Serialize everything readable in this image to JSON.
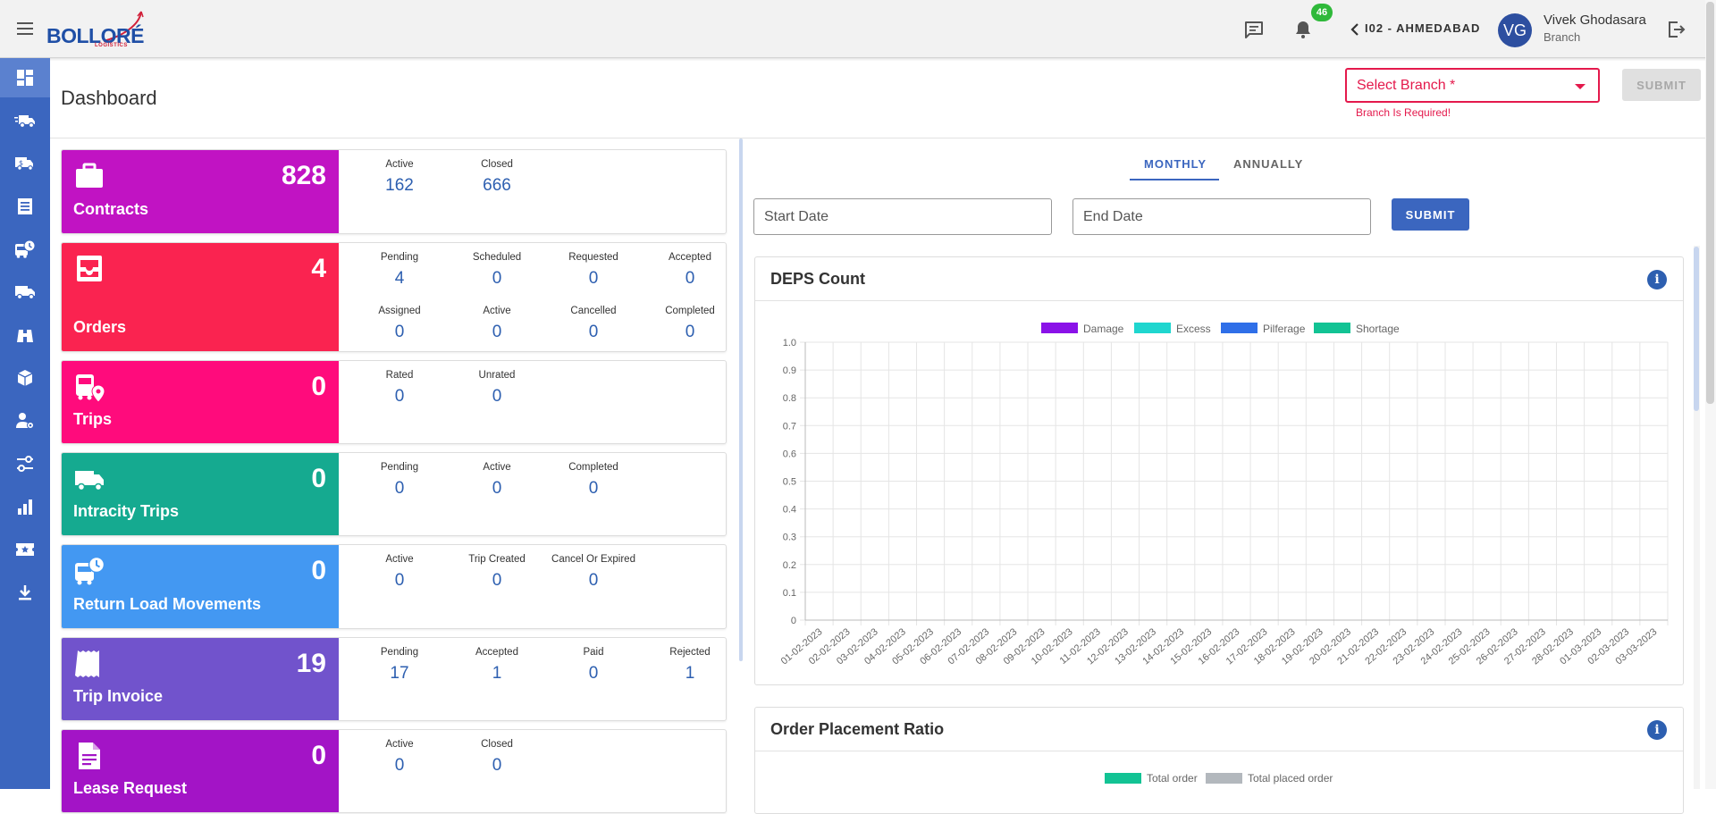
{
  "header": {
    "logo_text": "BOLLORÉ",
    "logo_sub": "LOGISTICS",
    "notification_count": "46",
    "branch_code": "I02 - AHMEDABAD",
    "avatar_initials": "VG",
    "user_name": "Vivek Ghodasara",
    "user_role": "Branch"
  },
  "page": {
    "title": "Dashboard",
    "branch_select_placeholder": "Select Branch *",
    "branch_error": "Branch Is Required!",
    "submit_label": "SUBMIT"
  },
  "sidebar": {
    "items": [
      {
        "icon": "dashboard-icon"
      },
      {
        "icon": "truck-fast-icon"
      },
      {
        "icon": "truck-money-icon"
      },
      {
        "icon": "list-document-icon"
      },
      {
        "icon": "bus-clock-icon"
      },
      {
        "icon": "delivery-truck-icon"
      },
      {
        "icon": "binoculars-icon"
      },
      {
        "icon": "package-icon"
      },
      {
        "icon": "user-settings-icon"
      },
      {
        "icon": "sliders-icon"
      },
      {
        "icon": "bar-chart-icon"
      },
      {
        "icon": "ticket-icon"
      },
      {
        "icon": "download-icon"
      }
    ]
  },
  "cards": [
    {
      "title": "Contracts",
      "count": "828",
      "color": "#c113c3",
      "icon": "briefcase-icon",
      "stats": [
        {
          "label": "Active",
          "value": "162"
        },
        {
          "label": "Closed",
          "value": "666"
        }
      ]
    },
    {
      "title": "Orders",
      "count": "4",
      "color": "#fa2350",
      "icon": "inbox-icon",
      "stats": [
        {
          "label": "Pending",
          "value": "4"
        },
        {
          "label": "Scheduled",
          "value": "0"
        },
        {
          "label": "Requested",
          "value": "0"
        },
        {
          "label": "Accepted",
          "value": "0"
        },
        {
          "label": "Assigned",
          "value": "0"
        },
        {
          "label": "Active",
          "value": "0"
        },
        {
          "label": "Cancelled",
          "value": "0"
        },
        {
          "label": "Completed",
          "value": "0"
        }
      ]
    },
    {
      "title": "Trips",
      "count": "0",
      "color": "#ff0b7c",
      "icon": "bus-pin-icon",
      "stats": [
        {
          "label": "Rated",
          "value": "0"
        },
        {
          "label": "Unrated",
          "value": "0"
        }
      ]
    },
    {
      "title": "Intracity Trips",
      "count": "0",
      "color": "#15aa90",
      "icon": "truck-icon",
      "stats": [
        {
          "label": "Pending",
          "value": "0"
        },
        {
          "label": "Active",
          "value": "0"
        },
        {
          "label": "Completed",
          "value": "0"
        }
      ]
    },
    {
      "title": "Return Load Movements",
      "count": "0",
      "color": "#4398f2",
      "icon": "bus-clock-icon",
      "stats": [
        {
          "label": "Active",
          "value": "0"
        },
        {
          "label": "Trip Created",
          "value": "0"
        },
        {
          "label": "Cancel Or Expired",
          "value": "0"
        }
      ]
    },
    {
      "title": "Trip Invoice",
      "count": "19",
      "color": "#7153cc",
      "icon": "receipt-icon",
      "stats": [
        {
          "label": "Pending",
          "value": "17"
        },
        {
          "label": "Accepted",
          "value": "1"
        },
        {
          "label": "Paid",
          "value": "0"
        },
        {
          "label": "Rejected",
          "value": "1"
        }
      ]
    },
    {
      "title": "Lease Request",
      "count": "0",
      "color": "#a314c6",
      "icon": "document-icon",
      "stats": [
        {
          "label": "Active",
          "value": "0"
        },
        {
          "label": "Closed",
          "value": "0"
        }
      ]
    }
  ],
  "tabs": [
    {
      "label": "MONTHLY"
    },
    {
      "label": "ANNUALLY"
    }
  ],
  "filters": {
    "start_placeholder": "Start Date",
    "end_placeholder": "End Date",
    "submit_label": "SUBMIT"
  },
  "chart_data": [
    {
      "type": "bar",
      "title": "DEPS Count",
      "xlabel": "",
      "ylabel": "",
      "ylim": [
        0,
        1.0
      ],
      "yticks": [
        "1.0",
        "0.9",
        "0.8",
        "0.7",
        "0.6",
        "0.5",
        "0.4",
        "0.3",
        "0.2",
        "0.1",
        "0"
      ],
      "grid": true,
      "legend_position": "top",
      "categories": [
        "01-02-2023",
        "02-02-2023",
        "03-02-2023",
        "04-02-2023",
        "05-02-2023",
        "06-02-2023",
        "07-02-2023",
        "08-02-2023",
        "09-02-2023",
        "10-02-2023",
        "11-02-2023",
        "12-02-2023",
        "13-02-2023",
        "14-02-2023",
        "15-02-2023",
        "16-02-2023",
        "17-02-2023",
        "18-02-2023",
        "19-02-2023",
        "20-02-2023",
        "21-02-2023",
        "22-02-2023",
        "23-02-2023",
        "24-02-2023",
        "25-02-2023",
        "26-02-2023",
        "27-02-2023",
        "28-02-2023",
        "01-03-2023",
        "02-03-2023",
        "03-03-2023"
      ],
      "series": [
        {
          "name": "Damage",
          "color": "#8a12e8",
          "values": [
            0,
            0,
            0,
            0,
            0,
            0,
            0,
            0,
            0,
            0,
            0,
            0,
            0,
            0,
            0,
            0,
            0,
            0,
            0,
            0,
            0,
            0,
            0,
            0,
            0,
            0,
            0,
            0,
            0,
            0,
            0
          ]
        },
        {
          "name": "Excess",
          "color": "#1fd6cf",
          "values": [
            0,
            0,
            0,
            0,
            0,
            0,
            0,
            0,
            0,
            0,
            0,
            0,
            0,
            0,
            0,
            0,
            0,
            0,
            0,
            0,
            0,
            0,
            0,
            0,
            0,
            0,
            0,
            0,
            0,
            0,
            0
          ]
        },
        {
          "name": "Pilferage",
          "color": "#2f6fe8",
          "values": [
            0,
            0,
            0,
            0,
            0,
            0,
            0,
            0,
            0,
            0,
            0,
            0,
            0,
            0,
            0,
            0,
            0,
            0,
            0,
            0,
            0,
            0,
            0,
            0,
            0,
            0,
            0,
            0,
            0,
            0,
            0
          ]
        },
        {
          "name": "Shortage",
          "color": "#12c394",
          "values": [
            0,
            0,
            0,
            0,
            0,
            0,
            0,
            0,
            0,
            0,
            0,
            0,
            0,
            0,
            0,
            0,
            0,
            0,
            0,
            0,
            0,
            0,
            0,
            0,
            0,
            0,
            0,
            0,
            0,
            0,
            0
          ]
        }
      ]
    },
    {
      "type": "bar",
      "title": "Order Placement Ratio",
      "legend_position": "top",
      "series": [
        {
          "name": "Total order",
          "color": "#12c394"
        },
        {
          "name": "Total placed order",
          "color": "#b3b8bd"
        }
      ]
    }
  ]
}
